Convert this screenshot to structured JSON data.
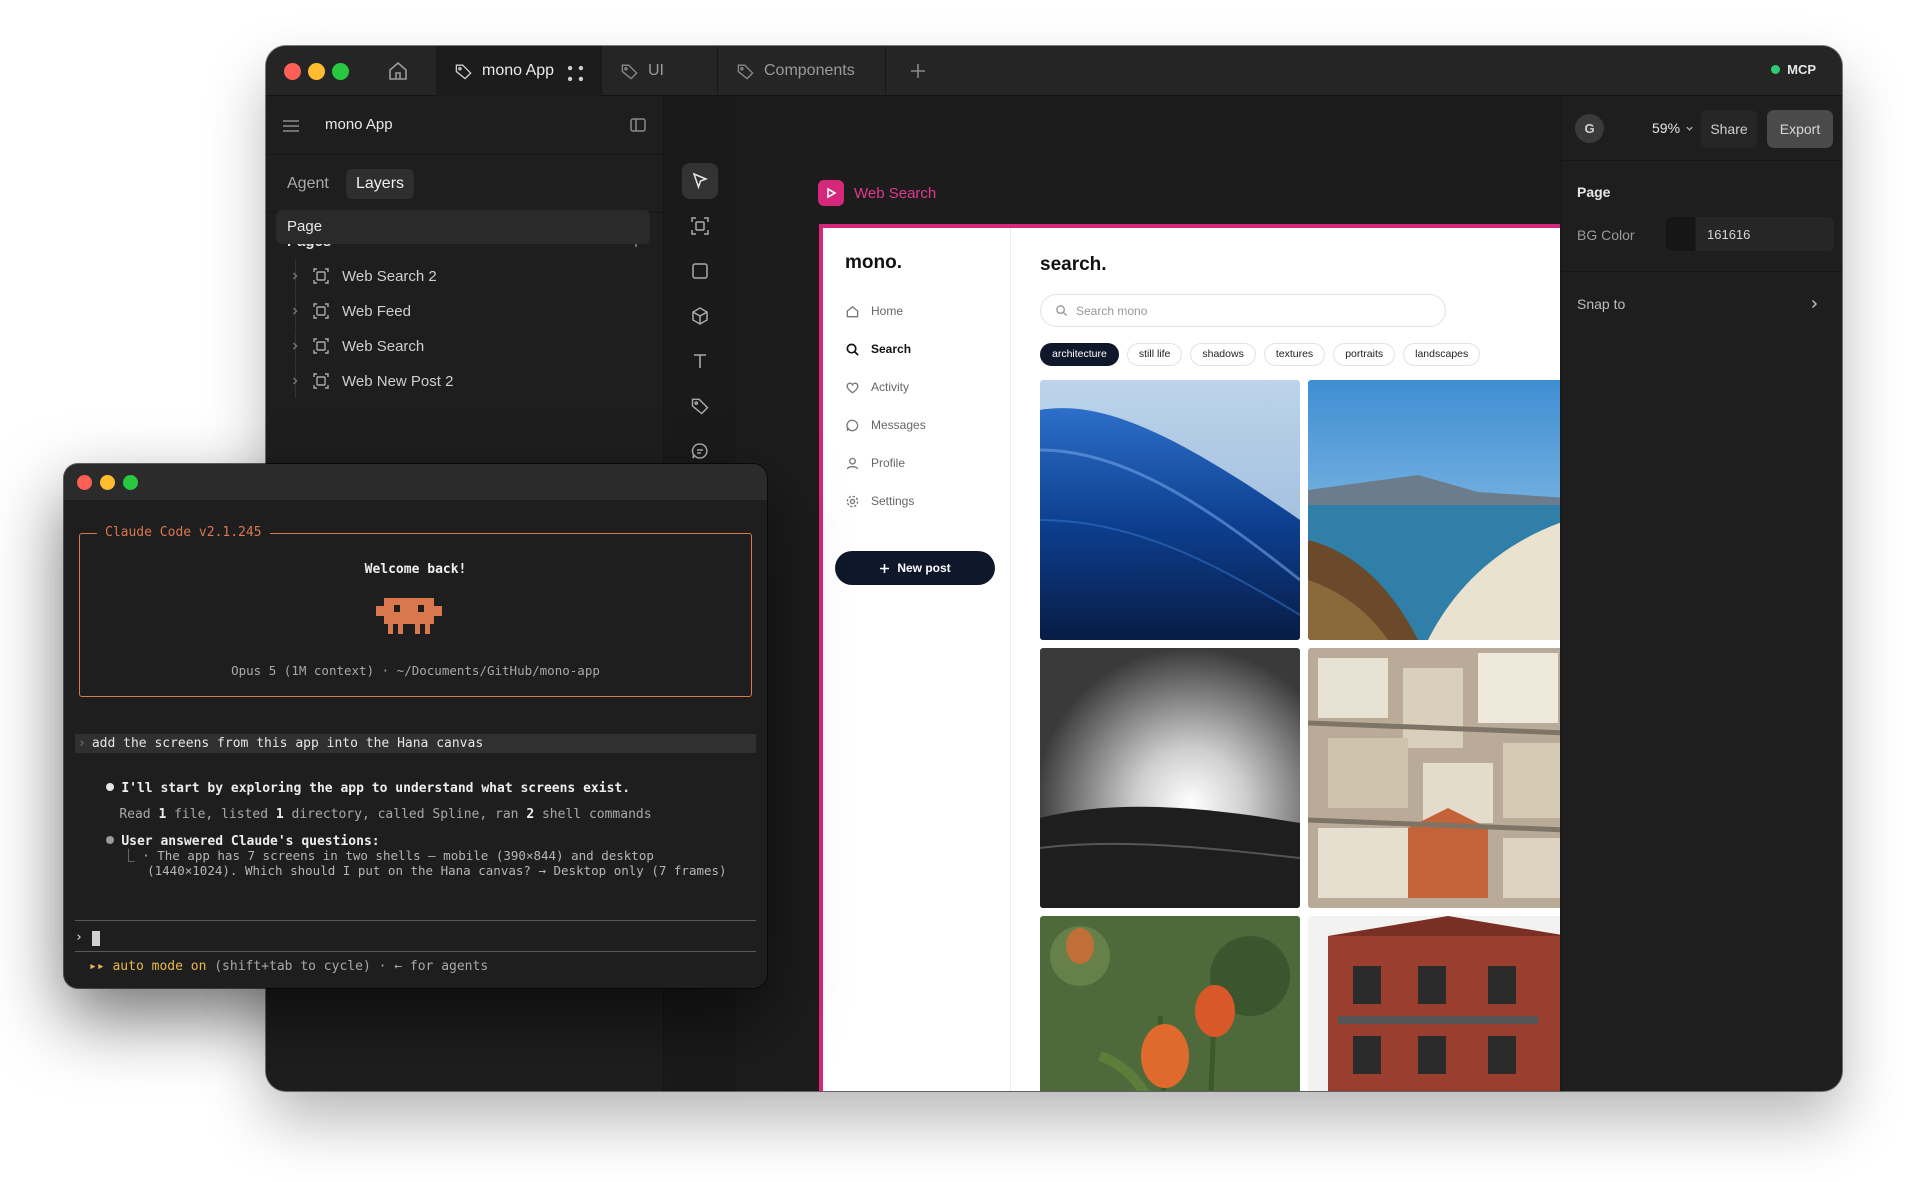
{
  "app": {
    "tabs": [
      {
        "label": "mono App",
        "icon": "tag-icon"
      },
      {
        "label": "UI",
        "icon": "tag-icon"
      },
      {
        "label": "Components",
        "icon": "tag-icon"
      }
    ],
    "status": "MCP"
  },
  "left_panel": {
    "title": "mono App",
    "tabs": [
      "Agent",
      "Layers"
    ],
    "active_tab": "Layers",
    "pages_label": "Pages",
    "pages": [
      "Page"
    ],
    "layers": [
      "Web Search 2",
      "Web Feed",
      "Web Search",
      "Web New Post 2"
    ]
  },
  "canvas": {
    "frame_label": "Web Search",
    "mock": {
      "logo": "mono.",
      "nav": [
        "Home",
        "Search",
        "Activity",
        "Messages",
        "Profile",
        "Settings"
      ],
      "active_nav": "Search",
      "new_post": "New post",
      "title": "search.",
      "search_placeholder": "Search mono",
      "chips": [
        "architecture",
        "still life",
        "shadows",
        "textures",
        "portraits",
        "landscapes"
      ],
      "active_chip": "architecture"
    }
  },
  "right_panel": {
    "avatar": "G",
    "zoom": "59%",
    "share": "Share",
    "export": "Export",
    "section_title": "Page",
    "bg_color_label": "BG Color",
    "bg_color_value": "161616",
    "snap_label": "Snap to"
  },
  "terminal": {
    "box_title": "Claude Code v2.1.245",
    "welcome": "Welcome back!",
    "model_line": "Opus 5 (1M context) · ~/Documents/GitHub/mono-app",
    "user_prompt": "add the screens from this app into the Hana canvas",
    "line1": "I'll start by exploring the app to understand what screens exist.",
    "line2_parts": [
      "Read ",
      "1",
      " file, listed ",
      "1",
      " directory, called Spline, ran ",
      "2",
      " shell commands"
    ],
    "line3": "User answered Claude's questions:",
    "line4": "· The app has 7 screens in two shells — mobile (390×844) and desktop",
    "line5": "(1440×1024). Which should I put on the Hana canvas? → Desktop only (7 frames)",
    "auto_mode": "▸▸ auto mode on",
    "auto_hint": " (shift+tab to cycle) · ← for agents"
  },
  "colors": {
    "accent_pink": "#d6287b",
    "claude_orange": "#d9774f",
    "mcp_green": "#2ecc71",
    "auto_yellow": "#e8b84a"
  }
}
